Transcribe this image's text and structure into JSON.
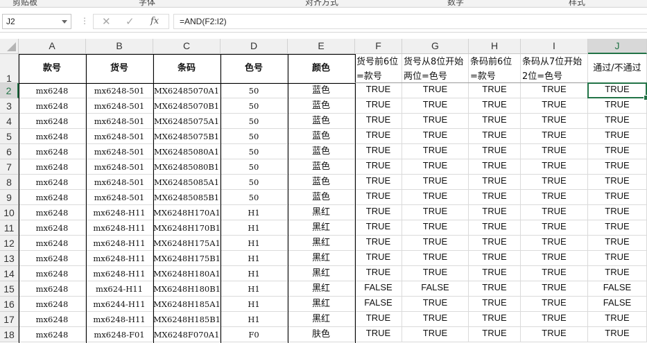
{
  "ribbon_fragments": [
    "剪贴板",
    "字体",
    "对齐方式",
    "数字",
    "样式"
  ],
  "formula_bar": {
    "name_box": "J2",
    "cancel_icon": "✕",
    "enter_icon": "✓",
    "fx_label": "fx",
    "formula": "=AND(F2:I2)"
  },
  "column_letters": [
    "A",
    "B",
    "C",
    "D",
    "E",
    "F",
    "G",
    "H",
    "I",
    "J"
  ],
  "selected_cell": "J2",
  "headers": [
    "款号",
    "货号",
    "条码",
    "色号",
    "颜色",
    "货号前6位=款号",
    "货号从8位开始两位=色号",
    "条码前6位=款号",
    "条码从7位开始2位=色号",
    "通过/不通过"
  ],
  "rows": [
    [
      "mx6248",
      "mx6248-501",
      "MX62485070A1",
      "50",
      "蓝色",
      "TRUE",
      "TRUE",
      "TRUE",
      "TRUE",
      "TRUE"
    ],
    [
      "mx6248",
      "mx6248-501",
      "MX62485070B1",
      "50",
      "蓝色",
      "TRUE",
      "TRUE",
      "TRUE",
      "TRUE",
      "TRUE"
    ],
    [
      "mx6248",
      "mx6248-501",
      "MX62485075A1",
      "50",
      "蓝色",
      "TRUE",
      "TRUE",
      "TRUE",
      "TRUE",
      "TRUE"
    ],
    [
      "mx6248",
      "mx6248-501",
      "MX62485075B1",
      "50",
      "蓝色",
      "TRUE",
      "TRUE",
      "TRUE",
      "TRUE",
      "TRUE"
    ],
    [
      "mx6248",
      "mx6248-501",
      "MX62485080A1",
      "50",
      "蓝色",
      "TRUE",
      "TRUE",
      "TRUE",
      "TRUE",
      "TRUE"
    ],
    [
      "mx6248",
      "mx6248-501",
      "MX62485080B1",
      "50",
      "蓝色",
      "TRUE",
      "TRUE",
      "TRUE",
      "TRUE",
      "TRUE"
    ],
    [
      "mx6248",
      "mx6248-501",
      "MX62485085A1",
      "50",
      "蓝色",
      "TRUE",
      "TRUE",
      "TRUE",
      "TRUE",
      "TRUE"
    ],
    [
      "mx6248",
      "mx6248-501",
      "MX62485085B1",
      "50",
      "蓝色",
      "TRUE",
      "TRUE",
      "TRUE",
      "TRUE",
      "TRUE"
    ],
    [
      "mx6248",
      "mx6248-H11",
      "MX6248H170A1",
      "H1",
      "黑红",
      "TRUE",
      "TRUE",
      "TRUE",
      "TRUE",
      "TRUE"
    ],
    [
      "mx6248",
      "mx6248-H11",
      "MX6248H170B1",
      "H1",
      "黑红",
      "TRUE",
      "TRUE",
      "TRUE",
      "TRUE",
      "TRUE"
    ],
    [
      "mx6248",
      "mx6248-H11",
      "MX6248H175A1",
      "H1",
      "黑红",
      "TRUE",
      "TRUE",
      "TRUE",
      "TRUE",
      "TRUE"
    ],
    [
      "mx6248",
      "mx6248-H11",
      "MX6248H175B1",
      "H1",
      "黑红",
      "TRUE",
      "TRUE",
      "TRUE",
      "TRUE",
      "TRUE"
    ],
    [
      "mx6248",
      "mx6248-H11",
      "MX6248H180A1",
      "H1",
      "黑红",
      "TRUE",
      "TRUE",
      "TRUE",
      "TRUE",
      "TRUE"
    ],
    [
      "mx6248",
      "mx624-H11",
      "MX6248H180B1",
      "H1",
      "黑红",
      "FALSE",
      "FALSE",
      "TRUE",
      "TRUE",
      "FALSE"
    ],
    [
      "mx6248",
      "mx6244-H11",
      "MX6248H185A1",
      "H1",
      "黑红",
      "FALSE",
      "TRUE",
      "TRUE",
      "TRUE",
      "FALSE"
    ],
    [
      "mx6248",
      "mx6248-H11",
      "MX6248H185B1",
      "H1",
      "黑红",
      "TRUE",
      "TRUE",
      "TRUE",
      "TRUE",
      "TRUE"
    ],
    [
      "mx6248",
      "mx6248-F01",
      "MX6248F070A1",
      "F0",
      "肤色",
      "TRUE",
      "TRUE",
      "TRUE",
      "TRUE",
      "TRUE"
    ]
  ],
  "colors": {
    "selection": "#217346",
    "header_bg": "#f0f0f0",
    "gridline": "#dadada"
  }
}
